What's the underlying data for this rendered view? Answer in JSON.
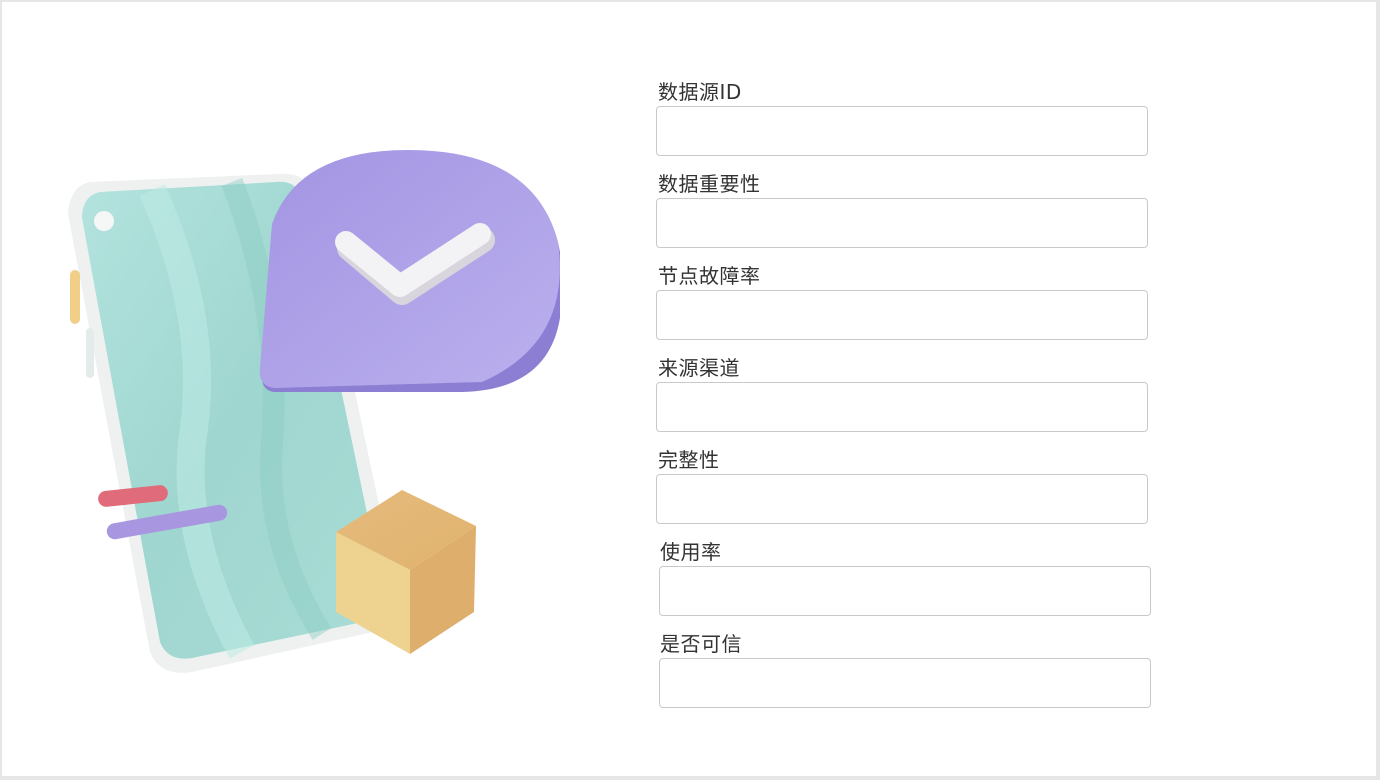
{
  "form": {
    "fields": [
      {
        "label": "数据源ID",
        "value": "",
        "placeholder": ""
      },
      {
        "label": "数据重要性",
        "value": "",
        "placeholder": ""
      },
      {
        "label": "节点故障率",
        "value": "",
        "placeholder": ""
      },
      {
        "label": "来源渠道",
        "value": "",
        "placeholder": ""
      },
      {
        "label": "完整性",
        "value": "",
        "placeholder": ""
      },
      {
        "label": "使用率",
        "value": "",
        "placeholder": ""
      },
      {
        "label": "是否可信",
        "value": "",
        "placeholder": ""
      }
    ]
  },
  "illustration": {
    "icon": "phone-with-check-bubble-illustration",
    "colors": {
      "screen": "#9fd8d2",
      "bubble": "#b3a6e8",
      "cube": "#e7c17f",
      "pill_red": "#e06b7a",
      "pill_purple": "#a996e0"
    }
  }
}
